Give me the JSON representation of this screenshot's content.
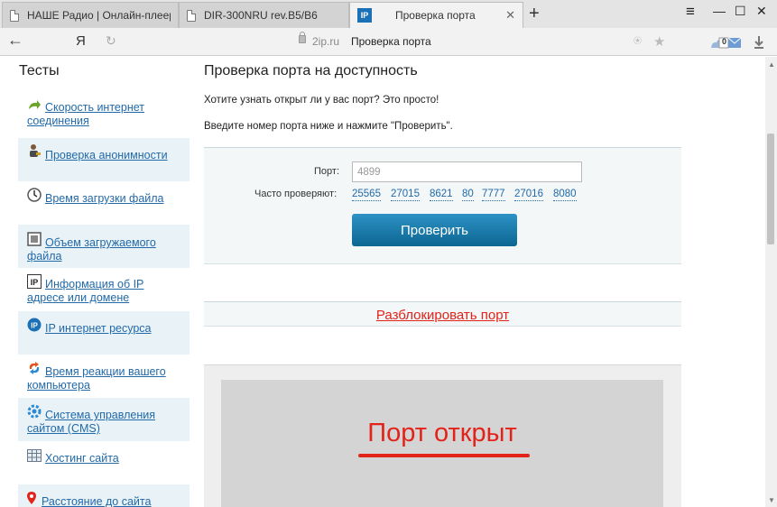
{
  "browser": {
    "tabs": [
      {
        "title": "НАШЕ Радио | Онлайн-плеер",
        "active": false
      },
      {
        "title": "DIR-300NRU rev.B5/B6",
        "active": false
      },
      {
        "title": "Проверка порта",
        "active": true,
        "favicon": "IP"
      }
    ],
    "new_tab": "+",
    "window_controls": {
      "menu": "≡",
      "minimize": "—",
      "maximize": "☐",
      "close": "✕"
    },
    "back": "←",
    "yandex_button": "Я",
    "reload": "↻",
    "domain": "2ip.ru",
    "page_title": "Проверка порта",
    "mail_count": "0"
  },
  "sidebar": {
    "title": "Тесты",
    "items": [
      {
        "label": "Скорость интернет соединения",
        "icon": "speed-arrow-icon",
        "shaded": false
      },
      {
        "label": "Проверка анонимности",
        "icon": "anonymity-person-icon",
        "shaded": true
      },
      {
        "label": "Время загрузки файла",
        "icon": "clock-icon",
        "shaded": false
      },
      {
        "label": "Объем загружаемого файла",
        "icon": "file-size-icon",
        "shaded": true
      },
      {
        "label": "Информация об IP адресе или домене",
        "icon": "ip-info-icon",
        "shaded": false
      },
      {
        "label": "IP интернет ресурса",
        "icon": "ip-resource-icon",
        "shaded": true
      },
      {
        "label": "Время реакции вашего компьютера",
        "icon": "reaction-arrows-icon",
        "shaded": false
      },
      {
        "label": "Система управления сайтом (CMS)",
        "icon": "cms-gear-icon",
        "shaded": true
      },
      {
        "label": "Хостинг сайта",
        "icon": "hosting-table-icon",
        "shaded": false
      },
      {
        "label": "Расстояние до сайта",
        "icon": "map-pin-icon",
        "shaded": true
      }
    ]
  },
  "main": {
    "title": "Проверка порта на доступность",
    "intro_line1": "Хотите узнать открыт ли у вас порт? Это просто!",
    "intro_line2": "Введите номер порта ниже и нажмите \"Проверить\".",
    "port_label": "Порт:",
    "port_value": "4899",
    "frequent_label": "Часто проверяют:",
    "frequent_ports": [
      "25565",
      "27015",
      "8621",
      "80",
      "7777",
      "27016",
      "8080"
    ],
    "check_button": "Проверить",
    "unblock_link": "Разблокировать порт",
    "result_text": "Порт открыт"
  },
  "colors": {
    "link": "#2269a8",
    "accent_red": "#e2231a",
    "button_top": "#2c92c5",
    "button_bottom": "#0d6692",
    "sidebar_shade": "#e9f3f7"
  }
}
